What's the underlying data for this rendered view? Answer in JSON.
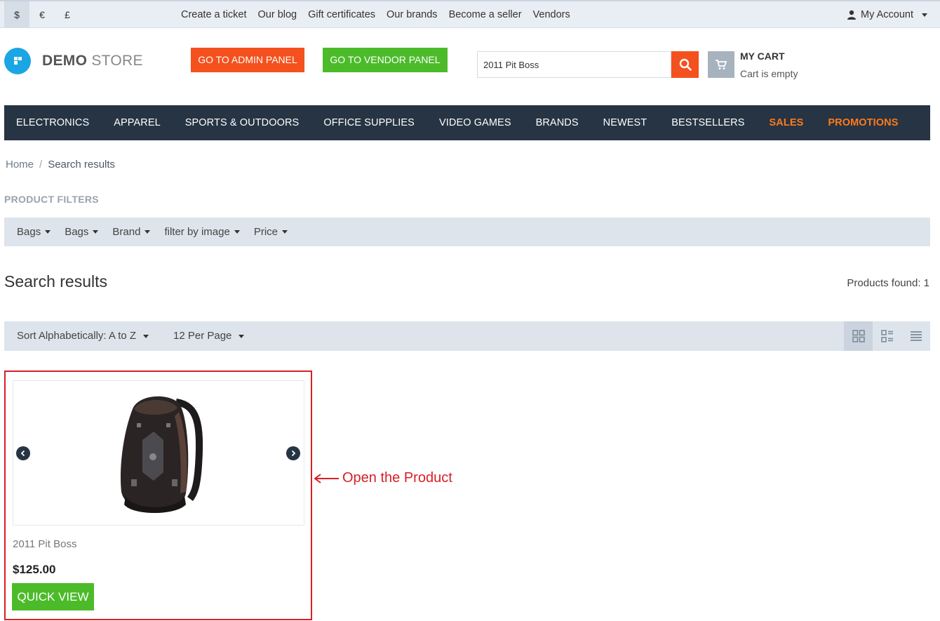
{
  "topbar": {
    "currencies": [
      "$",
      "€",
      "£"
    ],
    "links": [
      "Create a ticket",
      "Our blog",
      "Gift certificates",
      "Our brands",
      "Become a seller",
      "Vendors"
    ],
    "account": "My Account"
  },
  "header": {
    "logo_bold": "DEMO",
    "logo_light": "STORE",
    "admin_button": "GO TO ADMIN PANEL",
    "vendor_button": "GO TO VENDOR PANEL",
    "search_value": "2011 Pit Boss",
    "cart_title": "MY CART",
    "cart_status": "Cart is empty"
  },
  "nav": {
    "items": [
      "ELECTRONICS",
      "APPAREL",
      "SPORTS & OUTDOORS",
      "OFFICE SUPPLIES",
      "VIDEO GAMES",
      "BRANDS",
      "NEWEST",
      "BESTSELLERS"
    ],
    "highlight_items": [
      "SALES",
      "PROMOTIONS"
    ]
  },
  "breadcrumb": {
    "home": "Home",
    "separator": "/",
    "current": "Search results"
  },
  "filters": {
    "title": "PRODUCT FILTERS",
    "items": [
      "Bags",
      "Bags",
      "Brand",
      "filter by image",
      "Price"
    ]
  },
  "results": {
    "title": "Search results",
    "found": "Products found: 1",
    "sort": "Sort Alphabetically: A to Z",
    "per_page": "12 Per Page"
  },
  "product": {
    "name": "2011 Pit Boss",
    "price": "$125.00",
    "quick_view": "QUICK VIEW"
  },
  "annotation": {
    "text": "Open the Product"
  },
  "colors": {
    "accent_orange": "#f4511e",
    "accent_green": "#4cbb2a",
    "nav_bg": "#263444",
    "highlight_red": "#d81f26"
  }
}
